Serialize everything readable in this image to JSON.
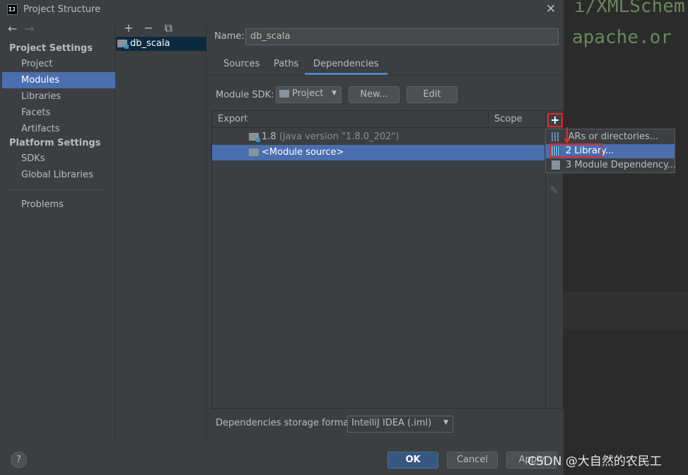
{
  "window": {
    "title": "Project Structure",
    "app_icon_text": "IJ"
  },
  "background": {
    "code_line_1": "i/XMLSchem",
    "code_line_2": "apache.or"
  },
  "sidebar": {
    "back_arrow": "←",
    "forward_arrow": "→",
    "sections": [
      {
        "title": "Project Settings",
        "items": [
          "Project",
          "Modules",
          "Libraries",
          "Facets",
          "Artifacts"
        ]
      },
      {
        "title": "Platform Settings",
        "items": [
          "SDKs",
          "Global Libraries"
        ]
      }
    ],
    "extra_item": "Problems",
    "selected": "Modules"
  },
  "modules": {
    "tool_add": "+",
    "tool_remove": "−",
    "tool_copy": "⧉",
    "items": [
      "db_scala"
    ]
  },
  "main": {
    "name_label": "Name:",
    "name_value": "db_scala",
    "tabs": [
      "Sources",
      "Paths",
      "Dependencies"
    ],
    "active_tab": "Dependencies",
    "sdk_label": "Module SDK:",
    "sdk_value": "Project",
    "new_button": "New...",
    "edit_button": "Edit",
    "table": {
      "col_export": "Export",
      "col_scope": "Scope",
      "rows": [
        {
          "name": "1.8",
          "detail": "(java version \"1.8.0_202\")"
        },
        {
          "name": "<Module source>",
          "detail": ""
        }
      ],
      "add_button": "+",
      "edit_icon": "✎"
    },
    "storage_label": "Dependencies storage format:",
    "storage_value": "IntelliJ IDEA (.iml)"
  },
  "popup": {
    "items": [
      {
        "index": "",
        "label": "JARs or directories..."
      },
      {
        "index": "2",
        "label": "Library..."
      },
      {
        "index": "3",
        "label": "Module Dependency..."
      }
    ],
    "highlighted": "Library..."
  },
  "footer": {
    "help": "?",
    "ok": "OK",
    "cancel": "Cancel",
    "apply": "Apply"
  },
  "watermark": "CSDN @大自然的农民工",
  "colors": {
    "accent": "#4b6eaf",
    "highlight_box": "#e0282a",
    "ok_button": "#365880"
  }
}
